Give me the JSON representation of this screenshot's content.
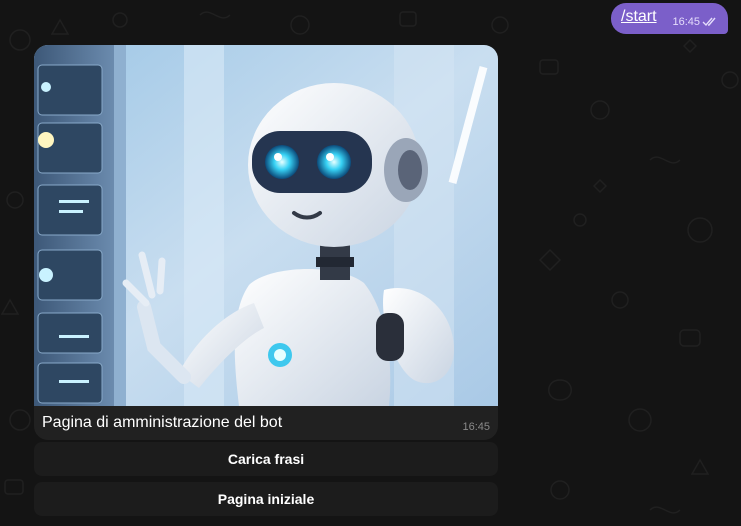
{
  "outgoing_message": {
    "text": "/start",
    "time": "16:45",
    "status_icon": "double-check-icon"
  },
  "photo_message": {
    "image": "robot-illustration",
    "caption": "Pagina di amministrazione del bot",
    "time": "16:45"
  },
  "keyboard": {
    "buttons": [
      {
        "label": "Carica frasi"
      },
      {
        "label": "Pagina iniziale"
      }
    ]
  },
  "colors": {
    "outgoing_bubble": "#7b5fc9",
    "background": "#141414",
    "caption_bg": "#212121"
  }
}
